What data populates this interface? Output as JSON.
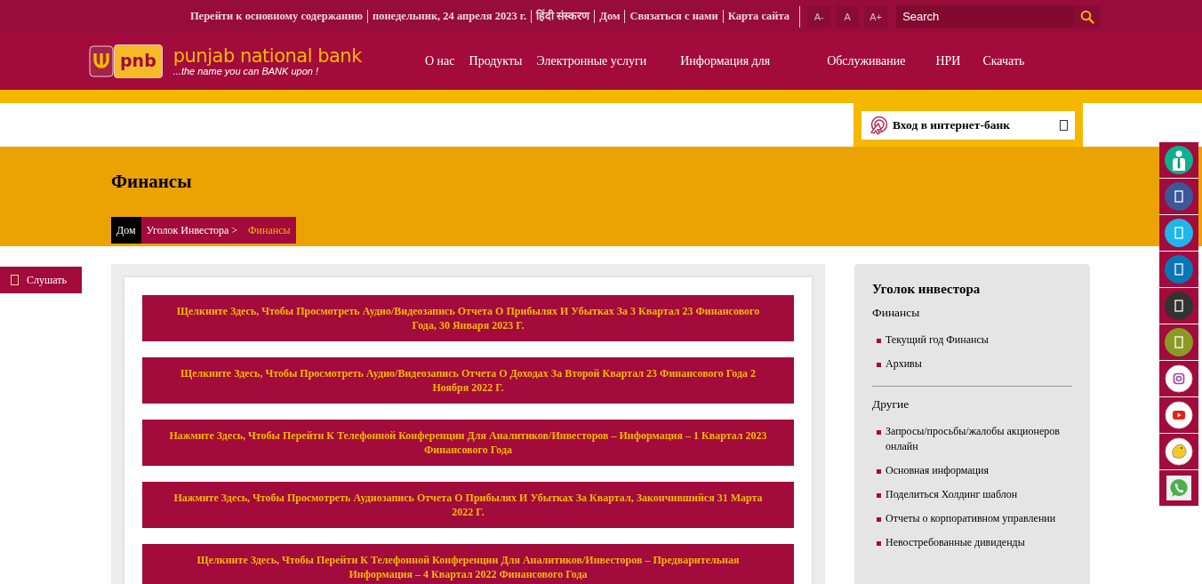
{
  "top_bar": {
    "items": [
      "Перейти к основному содержанию",
      "понедельник, 24 апреля 2023 г.",
      "हिंदी संस्करण",
      "Дом",
      "Связаться с нами",
      "Карта сайта"
    ],
    "font_sizes": [
      "A-",
      "A",
      "A+"
    ],
    "search": {
      "placeholder": "Search"
    }
  },
  "logo": {
    "mark": "pnb",
    "name": "punjab national bank",
    "tagline": "...the name you can BANK upon !"
  },
  "nav": [
    "О нас",
    "Продукты",
    "Электронные услуги",
    "Информация для",
    "Обслуживание",
    "НРИ",
    "Скачать"
  ],
  "login": {
    "label": "Вход в интернет-банк"
  },
  "page_title": "Финансы",
  "breadcrumb": [
    {
      "label": "Дом",
      "kind": "home"
    },
    {
      "label": "Уголок Инвестора >",
      "kind": "link"
    },
    {
      "label": "Финансы",
      "kind": "current"
    }
  ],
  "listen_button": "Слушать",
  "links": [
    "Щелкните Здесь, Чтобы Просмотреть Аудио/Видеозапись Отчета О Прибылях И Убытках За 3 Квартал 23 Финансового Года, 30 Января 2023 Г.",
    "Щелкните Здесь, Чтобы Просмотреть Аудио/Видеозапись Отчета О Доходах За Второй Квартал 23 Финансового Года 2 Ноября 2022 Г.",
    "Нажмите Здесь, Чтобы Перейти К Телефонной Конференции Для Аналитиков/Инвесторов – Информация – 1 Квартал 2023 Финансового Года",
    "Нажмите Здесь, Чтобы Просмотреть Аудиозапись Отчета О Прибылях И Убытках За Квартал, Закончившийся 31 Марта 2022 Г.",
    "Щелкните Здесь, Чтобы Перейти К Телефонной Конференции Для Аналитиков/Инвесторов – Предварительная Информация – 4 Квартал 2022 Финансового Года"
  ],
  "sidebar": {
    "title": "Уголок инвестора",
    "sections": [
      {
        "heading": "Финансы",
        "items": [
          "Текущий год Финансы",
          "Архивы"
        ]
      },
      {
        "heading": "Другие",
        "items": [
          "Запросы/просьбы/жалобы акционеров онлайн",
          "Основная информация",
          "Поделиться Холдинг шаблон",
          "Отчеты о корпоративном управлении",
          "Невостребованные дивиденды"
        ]
      }
    ]
  },
  "social_rail": [
    {
      "kind": "person",
      "color": "#0fb08f"
    },
    {
      "kind": "glyph",
      "color": "#3b5898"
    },
    {
      "kind": "glyph",
      "color": "#1fb6ea"
    },
    {
      "kind": "glyph",
      "color": "#0a77b5"
    },
    {
      "kind": "glyph",
      "color": "#333333"
    },
    {
      "kind": "glyph",
      "color": "#8b9a26"
    },
    {
      "kind": "camera",
      "color": "#ffffff"
    },
    {
      "kind": "play",
      "color": "#ffffff"
    },
    {
      "kind": "bird",
      "color": "#ffffff"
    },
    {
      "kind": "phone",
      "color": "#4caf50"
    }
  ]
}
